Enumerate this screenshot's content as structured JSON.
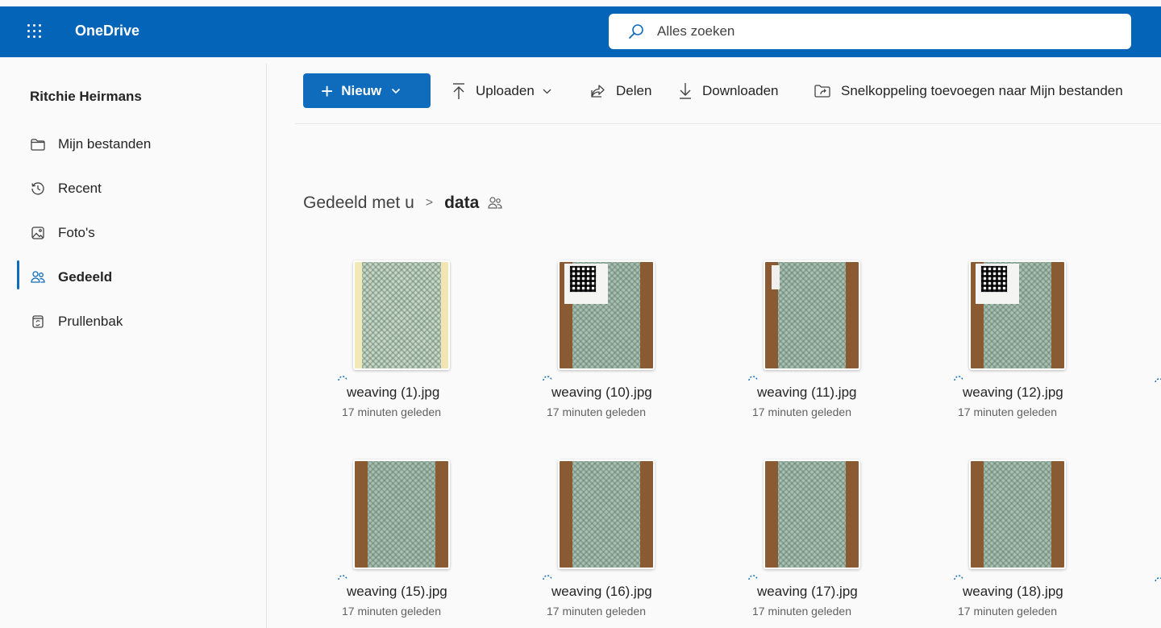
{
  "header": {
    "app_name": "OneDrive",
    "search_placeholder": "Alles zoeken"
  },
  "sidebar": {
    "user_name": "Ritchie Heirmans",
    "items": [
      {
        "label": "Mijn bestanden",
        "icon": "folder-icon",
        "active": false
      },
      {
        "label": "Recent",
        "icon": "history-icon",
        "active": false
      },
      {
        "label": "Foto's",
        "icon": "photo-icon",
        "active": false
      },
      {
        "label": "Gedeeld",
        "icon": "people-icon",
        "active": true
      },
      {
        "label": "Prullenbak",
        "icon": "recycle-bin-icon",
        "active": false
      }
    ]
  },
  "toolbar": {
    "new_label": "Nieuw",
    "upload_label": "Uploaden",
    "share_label": "Delen",
    "download_label": "Downloaden",
    "shortcut_label": "Snelkoppeling toevoegen naar Mijn bestanden"
  },
  "breadcrumb": {
    "root": "Gedeeld met u",
    "separator": ">",
    "current": "data"
  },
  "files": [
    {
      "name": "weaving (1).jpg",
      "modified": "17 minuten geleden",
      "thumb": "light"
    },
    {
      "name": "weaving (10).jpg",
      "modified": "17 minuten geleden",
      "thumb": "qr"
    },
    {
      "name": "weaving (11).jpg",
      "modified": "17 minuten geleden",
      "thumb": "tag"
    },
    {
      "name": "weaving (12).jpg",
      "modified": "17 minuten geleden",
      "thumb": "qr"
    },
    {
      "name": "weaving (15).jpg",
      "modified": "17 minuten geleden",
      "thumb": "wood"
    },
    {
      "name": "weaving (16).jpg",
      "modified": "17 minuten geleden",
      "thumb": "wood"
    },
    {
      "name": "weaving (17).jpg",
      "modified": "17 minuten geleden",
      "thumb": "wood"
    },
    {
      "name": "weaving (18).jpg",
      "modified": "17 minuten geleden",
      "thumb": "wood"
    }
  ],
  "colors": {
    "brand": "#0364b8",
    "accent": "#0f6cbd"
  }
}
